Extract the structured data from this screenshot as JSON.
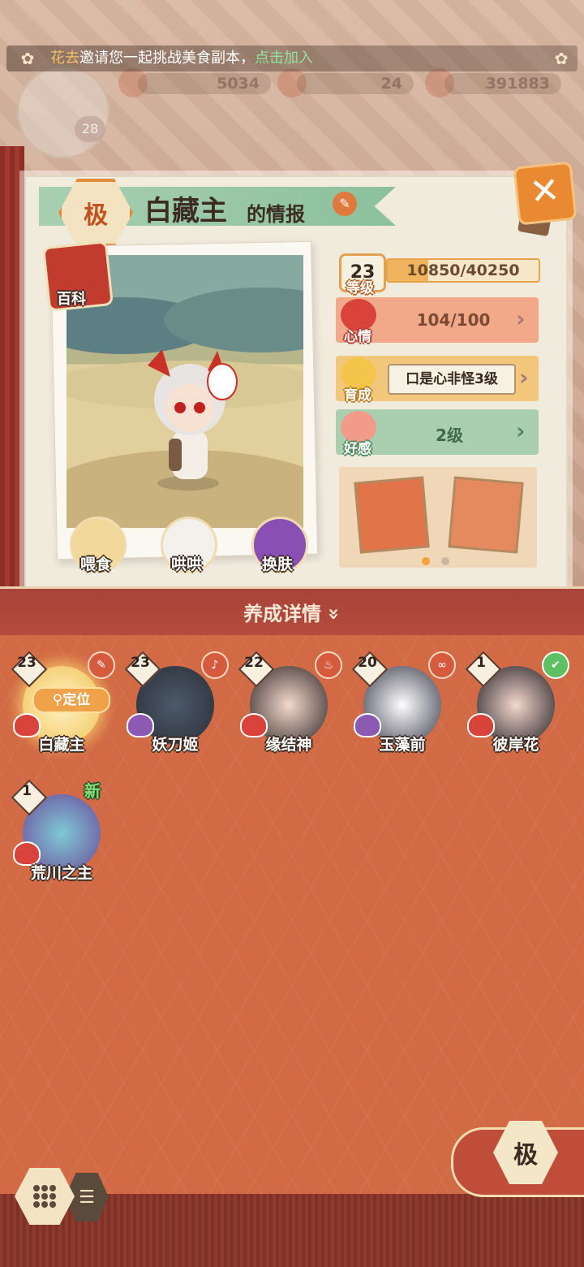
{
  "invite": {
    "name": "花去",
    "message": "邀请您一起挑战美食副本，",
    "link": "点击加入"
  },
  "player": {
    "level": "28"
  },
  "currency": [
    {
      "icon": "flower-coin-icon",
      "value": "5034"
    },
    {
      "icon": "fish-icon",
      "value": "24"
    },
    {
      "icon": "coin-icon",
      "value": "391883"
    }
  ],
  "character": {
    "grade": "极",
    "name": "白藏主",
    "name_suffix": "的情报",
    "wiki_label": "百科",
    "level": "23",
    "level_label": "等级",
    "exp_text": "10850/40250",
    "exp_fraction": 0.27,
    "mood_label": "心情",
    "mood_value": "104/100",
    "growth_label": "育成",
    "growth_value": "口是心非怪3级",
    "affection_label": "好感",
    "affection_value": "2级"
  },
  "actions": [
    {
      "name": "feed",
      "label": "喂食"
    },
    {
      "name": "coax",
      "label": "哄哄"
    },
    {
      "name": "skin",
      "label": "换肤"
    }
  ],
  "section": {
    "title": "养成详情",
    "chevron": "»"
  },
  "roster": [
    {
      "name": "白藏主",
      "level": "23",
      "mood": "red",
      "locate": "定位"
    },
    {
      "name": "妖刀姬",
      "level": "23",
      "mood": "purple"
    },
    {
      "name": "缘结神",
      "level": "22",
      "mood": "red"
    },
    {
      "name": "玉藻前",
      "level": "20",
      "mood": "purple"
    },
    {
      "name": "彼岸花",
      "level": "1",
      "mood": "red"
    },
    {
      "name": "荒川之主",
      "level": "1",
      "mood": "red",
      "tag": "新"
    }
  ],
  "filter": {
    "grade": "极"
  },
  "colors": {
    "mood_row": "#f1a98a",
    "growth_row": "#f2c77b",
    "affection_row": "#a9cfb0",
    "background": "#d26a46"
  }
}
